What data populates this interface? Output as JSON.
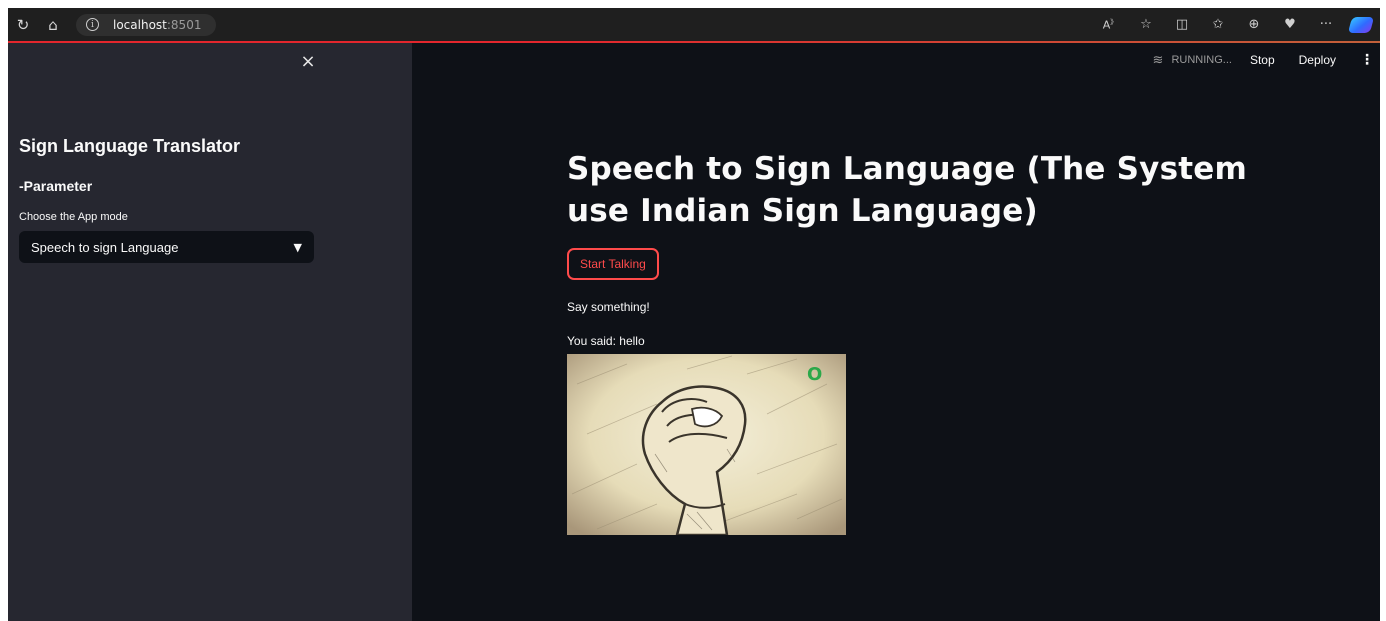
{
  "browser": {
    "url_host": "localhost",
    "url_port": ":8501"
  },
  "sidebar": {
    "close_symbol": "×",
    "title": "Sign Language Translator",
    "section": "-Parameter",
    "mode_label": "Choose the App mode",
    "mode_value": "Speech to sign Language"
  },
  "toolbar": {
    "status": "RUNNING...",
    "stop_label": "Stop",
    "deploy_label": "Deploy",
    "menu_symbol": "⋮"
  },
  "main": {
    "title": "Speech to Sign Language (The System use Indian Sign Language)",
    "button_label": "Start Talking",
    "prompt_text": "Say something!",
    "result_text": "You said: hello",
    "image_letter": "O"
  },
  "colors": {
    "sidebar_bg": "#262730",
    "main_bg": "#0e1117",
    "accent": "#ff4b4b"
  },
  "icons": [
    "refresh-icon",
    "home-icon",
    "info-icon",
    "read-aloud-icon",
    "favorite-icon",
    "split-screen-icon",
    "favorites-icon",
    "collections-icon",
    "health-icon",
    "more-icon",
    "copilot-icon",
    "close-icon",
    "chevron-down-icon",
    "running-icon",
    "kebab-menu-icon"
  ]
}
